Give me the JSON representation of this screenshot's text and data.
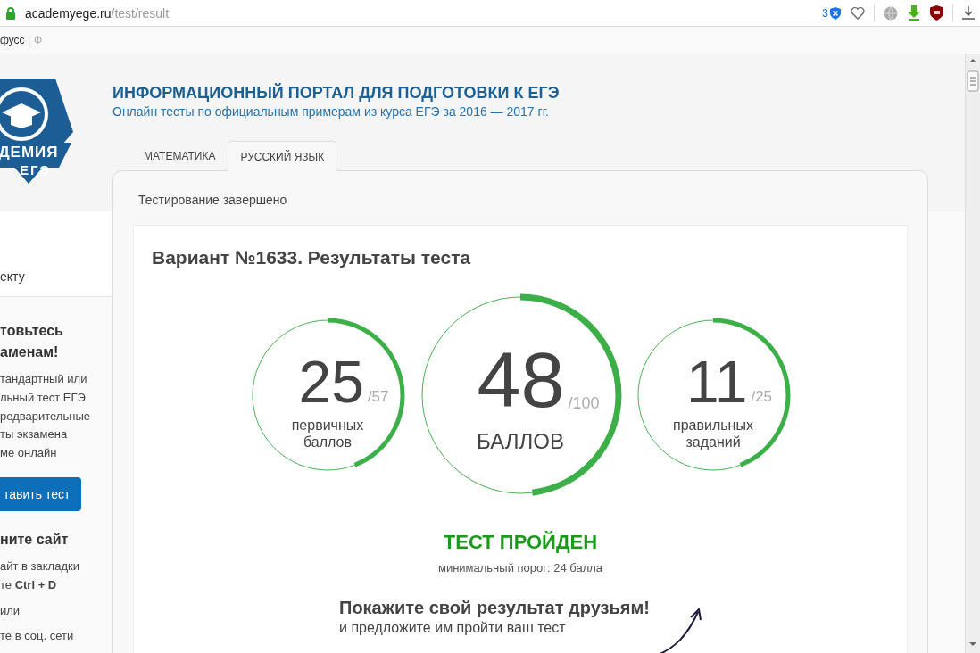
{
  "browser": {
    "url_host": "academyege.ru",
    "url_path": "/test/result",
    "badge_count": "3",
    "bookmarks": [
      "фусс |",
      "Ф"
    ]
  },
  "logo": {
    "line_1": "ДЕМИЯ",
    "line_2": "ЕГЭ"
  },
  "header": {
    "title": "ИНФОРМАЦИОННЫЙ ПОРТАЛ ДЛЯ ПОДГОТОВКИ К ЕГЭ",
    "subtitle": "Онлайн тесты по официальным примерам из курса ЕГЭ за 2016 — 2017 гг."
  },
  "tabs": [
    {
      "label": "МАТЕМАТИКА",
      "selected": false
    },
    {
      "label": "РУССКИЙ ЯЗЫК",
      "selected": true
    }
  ],
  "sidebar": {
    "link": "екту",
    "promo_heading": "товьтесь\nаменам!",
    "promo_text": "тандартный или\nльный тест ЕГЭ\nредварительные\nты экзамена\nме онлайн",
    "promo_button": "тавить тест",
    "save_heading": "ните сайт",
    "save_text": "айт в закладки\nте **Ctrl + D**",
    "or_text": "или",
    "share_text": "те в соц. сети"
  },
  "panel": {
    "status": "Тестирование завершено",
    "title": "Вариант №1633. Результаты теста",
    "scores": [
      {
        "kind": "small",
        "value": "25",
        "max": "/57",
        "label": "первичных\nбаллов"
      },
      {
        "kind": "large",
        "value": "48",
        "max": "/100",
        "label": "БАЛЛОВ"
      },
      {
        "kind": "small",
        "value": "11",
        "max": "/25",
        "label": "правильных\nзаданий"
      }
    ],
    "result": {
      "text": "ТЕСТ ПРОЙДЕН",
      "passed": true
    },
    "threshold": "минимальный порог: 24 балла",
    "share_heading": "Покажите свой результат друзьям!",
    "share_text": "и предложите им пройти ваш тест"
  }
}
